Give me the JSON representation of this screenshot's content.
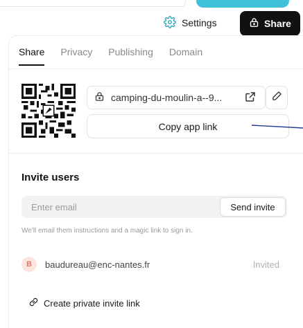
{
  "header": {
    "settings_label": "Settings",
    "settings_icon": "gear-icon",
    "share_label": "Share",
    "share_icon": "lock-icon",
    "accent_color": "#3fc1dc"
  },
  "tabs": [
    {
      "label": "Share",
      "active": true
    },
    {
      "label": "Privacy",
      "active": false
    },
    {
      "label": "Publishing",
      "active": false
    },
    {
      "label": "Domain",
      "active": false
    }
  ],
  "share_link": {
    "url_text": "camping-du-moulin-a--9...",
    "lock_icon": "lock-icon",
    "open_icon": "external-link-icon",
    "edit_icon": "pencil-icon",
    "copy_label": "Copy app link"
  },
  "invite": {
    "title": "Invite users",
    "email_placeholder": "Enter email",
    "send_label": "Send invite",
    "helper_text": "We'll email them instructions and a magic link to sign in."
  },
  "users": [
    {
      "initial": "B",
      "email": "baudureau@enc-nantes.fr",
      "status": "Invited"
    }
  ],
  "private_link": {
    "label": "Create private invite link",
    "icon": "link-icon"
  }
}
